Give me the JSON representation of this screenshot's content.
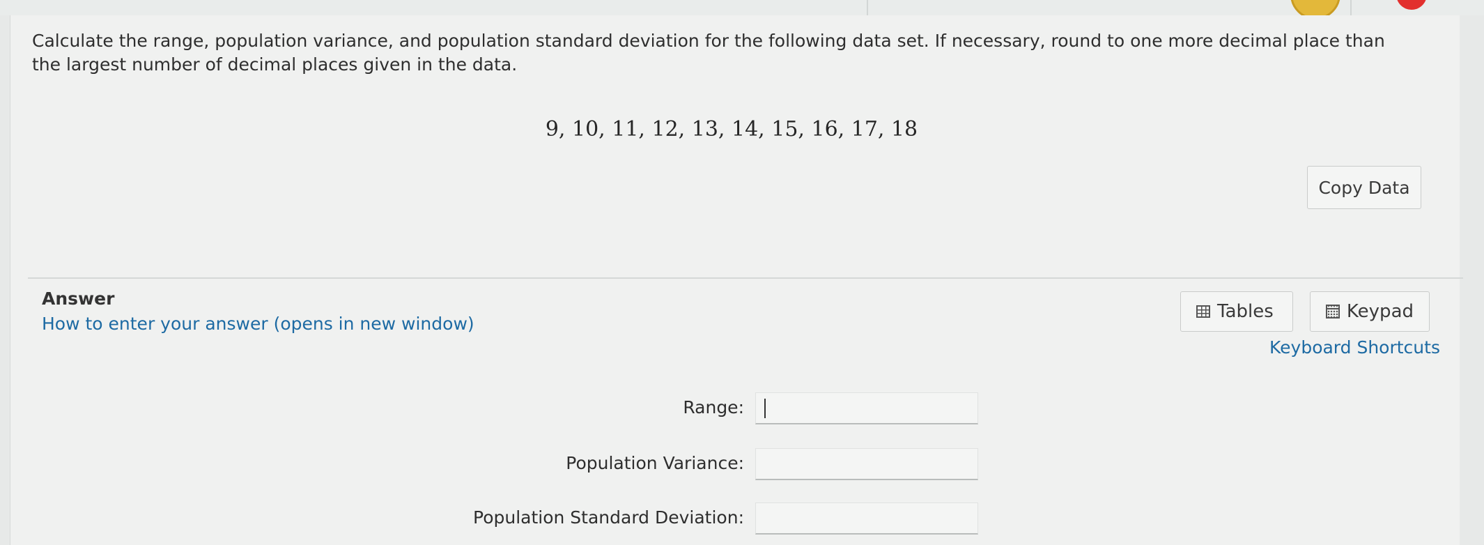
{
  "question": {
    "prompt": "Calculate the range, population variance, and population standard deviation for the following data set. If necessary, round to one more decimal place than the largest number of decimal places given in the data.",
    "dataset": "9, 10, 11, 12, 13, 14, 15, 16, 17, 18",
    "copy_data_label": "Copy Data"
  },
  "answer": {
    "heading": "Answer",
    "howto_link": "How to enter your answer (opens in new window)",
    "tables_label": "Tables",
    "keypad_label": "Keypad",
    "shortcuts_link": "Keyboard Shortcuts",
    "fields": {
      "range_label": "Range:",
      "range_value": "",
      "variance_label": "Population Variance:",
      "variance_value": "",
      "stddev_label": "Population Standard Deviation:",
      "stddev_value": ""
    }
  },
  "icons": {
    "tables": "table-grid-icon",
    "keypad": "calculator-keypad-icon"
  },
  "colors": {
    "link": "#1d6aa3",
    "background": "#f0f1f0",
    "badge_gold": "#e3b83a",
    "badge_red": "#e2302e"
  }
}
